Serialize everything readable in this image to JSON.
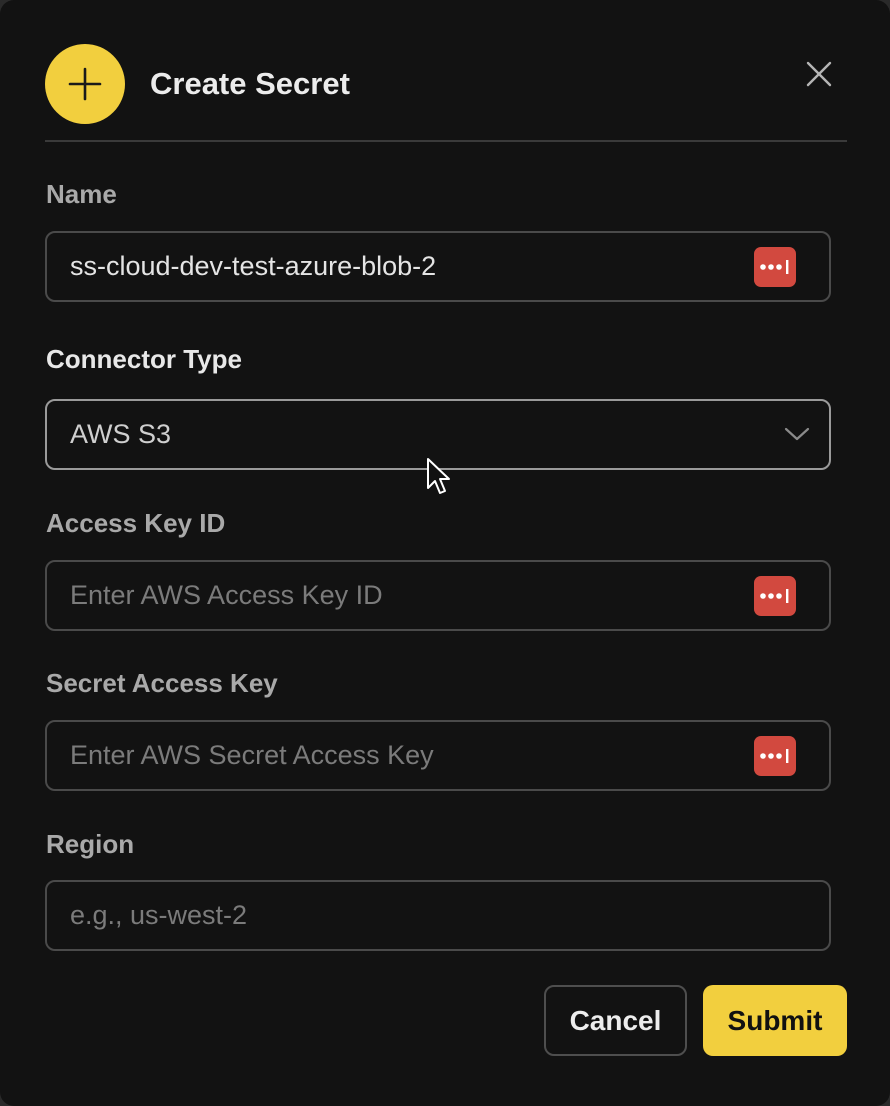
{
  "dialog": {
    "title": "Create Secret"
  },
  "fields": {
    "name": {
      "label": "Name",
      "value": "ss-cloud-dev-test-azure-blob-2"
    },
    "connector_type": {
      "label": "Connector Type",
      "selected": "AWS S3"
    },
    "access_key_id": {
      "label": "Access Key ID",
      "placeholder": "Enter AWS Access Key ID"
    },
    "secret_access_key": {
      "label": "Secret Access Key",
      "placeholder": "Enter AWS Secret Access Key"
    },
    "region": {
      "label": "Region",
      "placeholder": "e.g., us-west-2"
    }
  },
  "actions": {
    "cancel_label": "Cancel",
    "submit_label": "Submit"
  },
  "icons": {
    "header": "plus-icon",
    "close": "close-icon",
    "password_manager": "password-manager-icon",
    "dropdown": "chevron-down-icon"
  },
  "colors": {
    "accent": "#f2cf3e",
    "password_manager": "#d2493f",
    "background": "#121212"
  }
}
